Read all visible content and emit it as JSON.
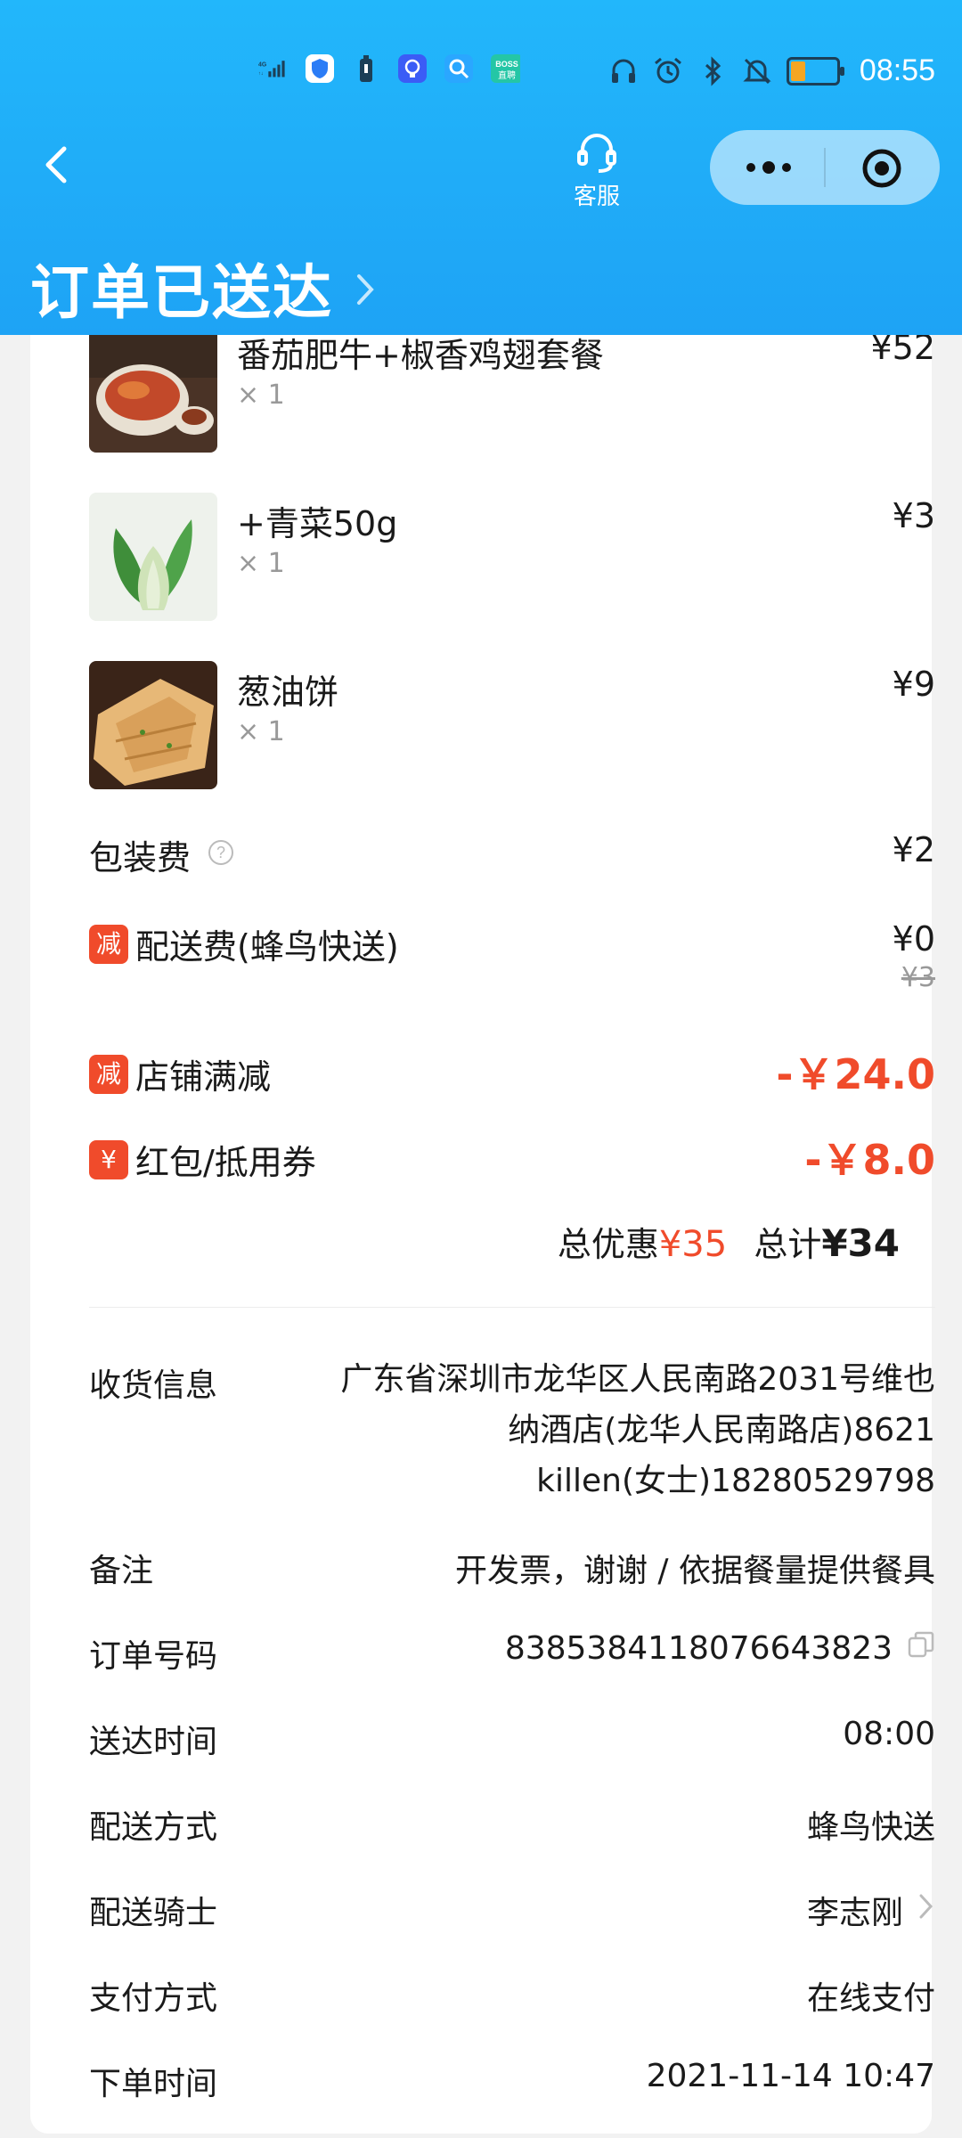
{
  "status_bar": {
    "time": "08:55",
    "left_icons": [
      "signal-4g-icon",
      "shield-app-icon",
      "battery-small-icon",
      "bulb-app-icon",
      "search-app-icon",
      "boss-app-icon"
    ],
    "right_icons": [
      "headphones-icon",
      "alarm-icon",
      "bluetooth-icon",
      "mute-bell-icon",
      "battery-icon"
    ]
  },
  "header": {
    "service_label": "客服",
    "title": "订单已送达",
    "colors": {
      "bg": "#1ea3f5"
    }
  },
  "items": [
    {
      "name": "番茄肥牛+椒香鸡翅套餐",
      "qty": "× 1",
      "price": "¥52"
    },
    {
      "name": "+青菜50g",
      "qty": "× 1",
      "price": "¥3"
    },
    {
      "name": "葱油饼",
      "qty": "× 1",
      "price": "¥9"
    }
  ],
  "fees": {
    "packaging": {
      "label": "包装费",
      "value": "¥2"
    },
    "delivery": {
      "tag": "减",
      "label": "配送费(蜂鸟快送)",
      "value": "¥0",
      "original": "¥3"
    },
    "store_discount": {
      "tag": "减",
      "label": "店铺满减",
      "value": "-￥24.0"
    },
    "coupon": {
      "tag": "¥",
      "label": "红包/抵用券",
      "value": "-￥8.0"
    }
  },
  "summary": {
    "discount_label": "总优惠",
    "discount_value": "¥35",
    "total_label": "总计",
    "total_value": "¥34"
  },
  "info": {
    "address_label": "收货信息",
    "address_line1": "广东省深圳市龙华区人民南路2031号维也",
    "address_line2": "纳酒店(龙华人民南路店)8621",
    "address_line3": "killen(女士)18280529798",
    "note_label": "备注",
    "note_value": "开发票，谢谢 / 依据餐量提供餐具",
    "order_no_label": "订单号码",
    "order_no_value": "8385384118076643823",
    "delivered_label": "送达时间",
    "delivered_value": "08:00",
    "method_label": "配送方式",
    "method_value": "蜂鸟快送",
    "rider_label": "配送骑士",
    "rider_value": "李志刚",
    "payment_label": "支付方式",
    "payment_value": "在线支付",
    "order_time_label": "下单时间",
    "order_time_value": "2021-11-14 10:47"
  },
  "colors": {
    "accent_red": "#f04b2b",
    "header_blue": "#1ea3f5"
  }
}
